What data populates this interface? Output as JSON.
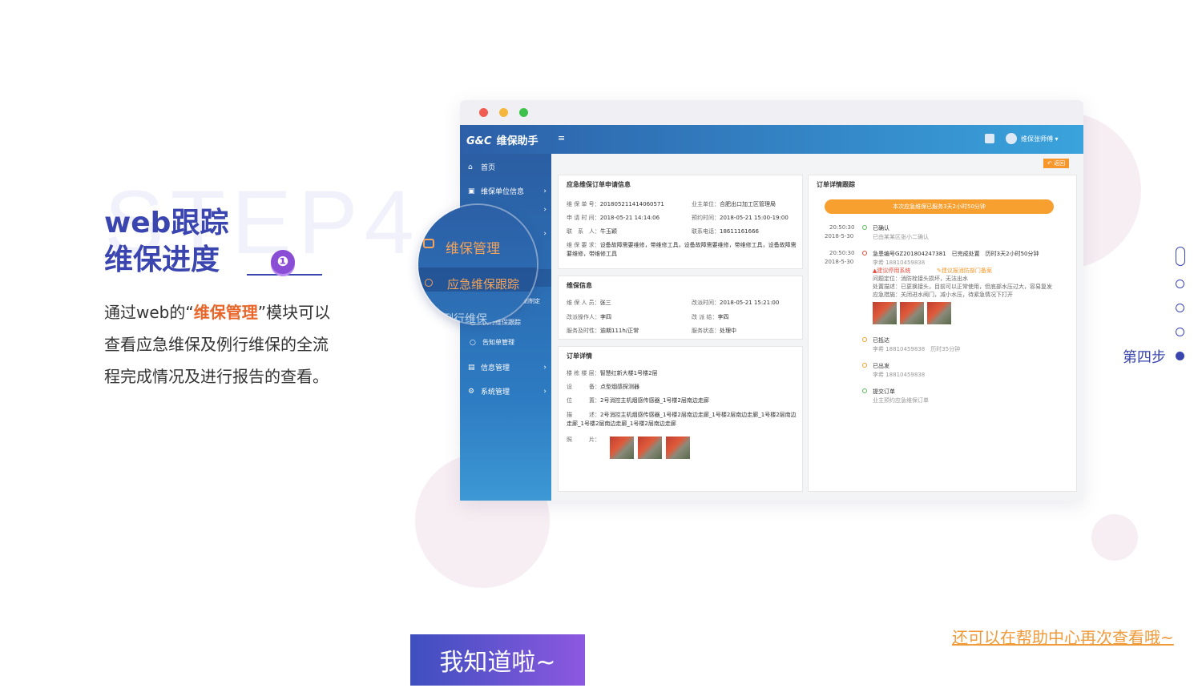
{
  "left": {
    "watermark": "STEP4",
    "title_line1": "web跟踪",
    "title_line2": "维保进度",
    "badge": "❶",
    "desc_pre": "通过web的“",
    "desc_hl": "维保管理",
    "desc_post": "”模块可以查看应急维保及例行维保的全流程完成情况及进行报告的查看。"
  },
  "app": {
    "logo_mark": "G&C",
    "title": "维保助手",
    "menu_icon": "≡",
    "user": "维保张师傅 ▾",
    "back": "↶ 返回",
    "sidebar": [
      {
        "icon": "⌂",
        "label": "首页"
      },
      {
        "icon": "▣",
        "label": "维保单位信息"
      },
      {
        "icon": "",
        "label": "报告信息"
      },
      {
        "icon": "",
        "label": "维保管理"
      },
      {
        "icon": "",
        "label": "应急维保跟踪"
      },
      {
        "icon": "",
        "label": "计划制定"
      },
      {
        "icon": "○",
        "label": "例行维保跟踪"
      },
      {
        "icon": "○",
        "label": "告知单管理"
      },
      {
        "icon": "▤",
        "label": "信息管理"
      },
      {
        "icon": "⚙",
        "label": "系统管理"
      }
    ],
    "apply": {
      "title": "应急维保订单申请信息",
      "rows": [
        {
          "k": "维 保 单 号：",
          "v": "201805211414060571",
          "k2": "业主单位：",
          "v2": "合肥出口加工区管理局"
        },
        {
          "k": "申 请 时 间：",
          "v": "2018-05-21 14:14:06",
          "k2": "预约时间：",
          "v2": "2018-05-21 15:00-19:00"
        },
        {
          "k": "联　系　人：",
          "v": "牛玉颖",
          "k2": "联系电话：",
          "v2": "18611161666"
        }
      ],
      "req_k": "维 保 要 求：",
      "req_v": "设备故障需要维修，带维修工具，设备故障需要维修，带维修工具，设备故障需要维修，带维修工具"
    },
    "info": {
      "title": "维保信息",
      "rows": [
        {
          "k": "维 保 人 员：",
          "v": "张三",
          "k2": "改派时间：",
          "v2": "2018-05-21 15:21:00"
        },
        {
          "k": "改派操作人：",
          "v": "李四",
          "k2": "改 派 给：",
          "v2": "李四"
        },
        {
          "k": "服务及时性：",
          "v": "逾期111h/正常",
          "k2": "服务状态：",
          "v2": "处理中"
        }
      ]
    },
    "detail": {
      "title": "订单详情",
      "rows": [
        {
          "k": "楼 栋 楼 层：",
          "v": "智慧红新大楼1号楼2层"
        },
        {
          "k": "设　　　备：",
          "v": "点型烟感探测器"
        },
        {
          "k": "位　　　置：",
          "v": "2号消控主机烟感传感器_1号楼2层南边走廊"
        },
        {
          "k": "描　　　述：",
          "v": "2号消控主机烟感传感器_1号楼2层南边走廊_1号楼2层南边走廊_1号楼2层南边走廊_1号楼2层南边走廊_1号楼2层南边走廊"
        }
      ],
      "photo_k": "照　　　片："
    },
    "track": {
      "title": "订单详情跟踪",
      "banner": "本次应急维保已服务3天2小时50分钟",
      "events": [
        {
          "time": "20:50:30",
          "date": "2018-5-30",
          "t": "已确认",
          "s": "已由某某区张小二确认"
        },
        {
          "time": "20:50:30",
          "date": "2018-5-30",
          "t": "急患编号GZ201804247381　已完成处置　历时3天2小时50分钟",
          "s": "李希 18810459838"
        },
        {
          "time": "",
          "date": "",
          "t": "已抵达",
          "s": "李希 18810459838　历时35分钟"
        },
        {
          "time": "",
          "date": "",
          "t": "已出发",
          "s": "李希 18810459838"
        },
        {
          "time": "",
          "date": "",
          "t": "提交订单",
          "s": "业主预约应急维保订单"
        }
      ],
      "warn1": "▲建议停用系统",
      "warn2": "✎建议报消防部门备案",
      "lines": [
        "问题定位：消防栓接头损坏，无法出水",
        "处置描述：已更换接头，目前可以正常使用，但底部水压过大，容易复发",
        "应急措施：关闭进水阀门，减小水压，待紧急情况下打开"
      ]
    },
    "magnifier": {
      "top": "维保管理",
      "active": "应急维保跟踪",
      "below": "例行维保"
    }
  },
  "right_nav": {
    "label": "第四步"
  },
  "cta": "我知道啦~",
  "help_link": "还可以在帮助中心再次查看哦~",
  "colors": {
    "primary": "#3a45b0",
    "accent": "#e8662a",
    "orange": "#f7a030",
    "link": "#f09a3a"
  }
}
